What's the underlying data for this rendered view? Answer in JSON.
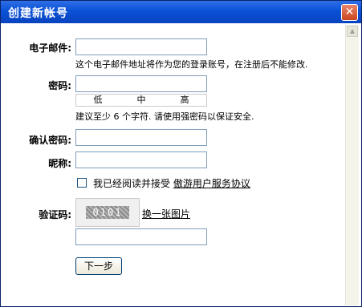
{
  "window": {
    "title": "创建新帐号",
    "close_glyph": "✕"
  },
  "form": {
    "email_label": "电子邮件:",
    "email_value": "",
    "email_hint": "这个电子邮件地址将作为您的登录账号，在注册后不能修改.",
    "password_label": "密码:",
    "password_value": "",
    "strength": [
      "低",
      "中",
      "高"
    ],
    "password_hint": "建议至少 6 个字符. 请使用强密码以保证安全.",
    "confirm_label": "确认密码:",
    "confirm_value": "",
    "nickname_label": "昵称:",
    "nickname_value": "",
    "agree_text": "我已经阅读并接受",
    "agree_link": "傲游用户服务协议",
    "agree_checked": false,
    "captcha_label": "验证码:",
    "captcha_code": "0101",
    "change_image": "换一张图片",
    "captcha_value": "",
    "next_button": "下一步"
  },
  "icons": {
    "close": "close-icon",
    "scroll_up": "scroll-up-arrow-icon"
  }
}
